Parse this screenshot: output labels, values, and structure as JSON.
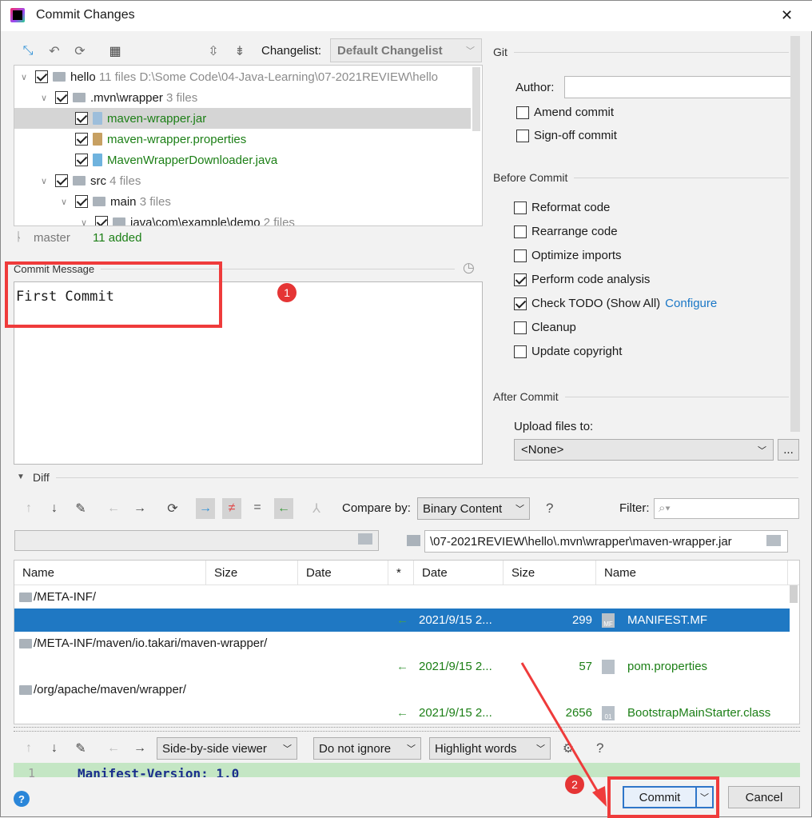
{
  "window": {
    "title": "Commit Changes",
    "close": "✕"
  },
  "toolbar": {
    "changelist_label": "Changelist:",
    "changelist_value": "Default Changelist"
  },
  "tree": [
    {
      "name": "hello",
      "meta": "11 files  D:\\Some Code\\04-Java-Learning\\07-2021REVIEW\\hello",
      "type": "module",
      "level": 0
    },
    {
      "name": ".mvn\\wrapper",
      "meta": "3 files",
      "type": "folder",
      "level": 1
    },
    {
      "name": "maven-wrapper.jar",
      "meta": "",
      "type": "jar",
      "level": 2
    },
    {
      "name": "maven-wrapper.properties",
      "meta": "",
      "type": "properties",
      "level": 2
    },
    {
      "name": "MavenWrapperDownloader.java",
      "meta": "",
      "type": "java",
      "level": 2
    },
    {
      "name": "src",
      "meta": "4 files",
      "type": "folder",
      "level": 1
    },
    {
      "name": "main",
      "meta": "3 files",
      "type": "folder",
      "level": 2
    },
    {
      "name": "java\\com\\example\\demo",
      "meta": "2 files",
      "type": "folder",
      "level": 3
    }
  ],
  "status": {
    "branch": "master",
    "added": "11 added"
  },
  "commit_message": {
    "label": "Commit Message",
    "value": "First Commit"
  },
  "annotations": {
    "one": "1",
    "two": "2"
  },
  "git": {
    "section": "Git",
    "author_label": "Author:",
    "author_value": "",
    "amend": "Amend commit",
    "signoff": "Sign-off commit"
  },
  "before_commit": {
    "section": "Before Commit",
    "options": [
      {
        "label": "Reformat code",
        "checked": false
      },
      {
        "label": "Rearrange code",
        "checked": false
      },
      {
        "label": "Optimize imports",
        "checked": false
      },
      {
        "label": "Perform code analysis",
        "checked": true
      },
      {
        "label": "Check TODO (Show All)",
        "checked": true,
        "link": "Configure"
      },
      {
        "label": "Cleanup",
        "checked": false
      },
      {
        "label": "Update copyright",
        "checked": false
      }
    ]
  },
  "after_commit": {
    "section": "After Commit",
    "upload_label": "Upload files to:",
    "upload_value": "<None>",
    "more": "..."
  },
  "diff": {
    "section": "Diff",
    "compare_label": "Compare by:",
    "compare_value": "Binary Content",
    "help": "?",
    "filter_label": "Filter:",
    "left_path": "",
    "right_path": "\\07-2021REVIEW\\hello\\.mvn\\wrapper\\maven-wrapper.jar",
    "columns": [
      "Name",
      "Size",
      "Date",
      "*",
      "Date",
      "Size",
      "Name"
    ],
    "rows": [
      {
        "folder": "/META-INF/"
      },
      {
        "date": "2021/9/15 2...",
        "size": "299",
        "name": "MANIFEST.MF",
        "icon": "MF",
        "selected": true
      },
      {
        "folder": "/META-INF/maven/io.takari/maven-wrapper/"
      },
      {
        "date": "2021/9/15 2...",
        "size": "57",
        "name": "pom.properties",
        "icon": "props"
      },
      {
        "folder": "/org/apache/maven/wrapper/"
      },
      {
        "date": "2021/9/15 2...",
        "size": "2656",
        "name": "BootstrapMainStarter.class",
        "icon": "01"
      }
    ],
    "viewer": "Side-by-side viewer",
    "whitespace": "Do not ignore",
    "highlight": "Highlight words",
    "line_no": "1",
    "line_text": "Manifest-Version: 1.0"
  },
  "buttons": {
    "commit": "Commit",
    "cancel": "Cancel",
    "help": "?"
  },
  "colors": {
    "accent": "#1a77c6",
    "selection": "#1f78c3",
    "added": "#1c7f16",
    "annotation": "#ef3b3b"
  }
}
